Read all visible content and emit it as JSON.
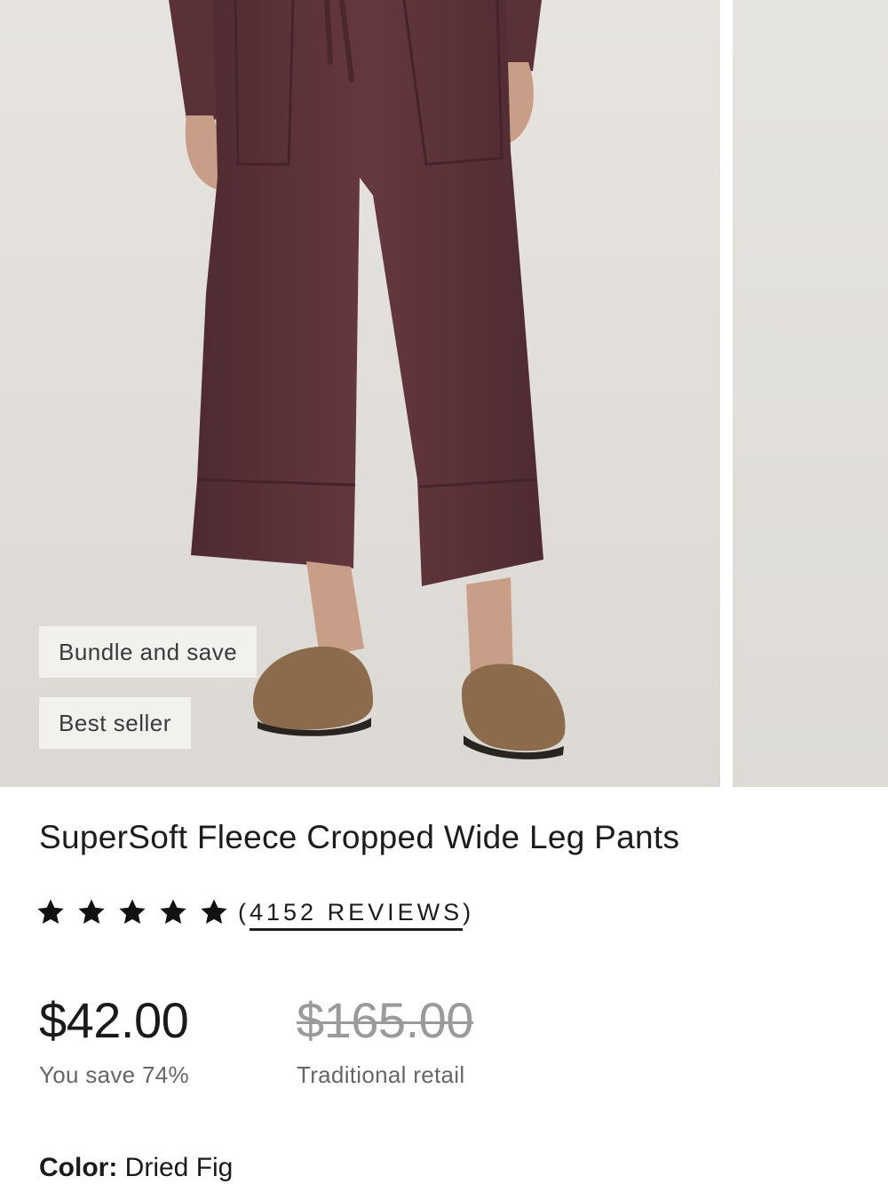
{
  "gallery": {
    "badges": [
      "Bundle and save",
      "Best seller"
    ]
  },
  "product": {
    "title": "SuperSoft Fleece Cropped Wide Leg Pants",
    "rating": {
      "stars": 5,
      "reviews_prefix": "(",
      "reviews_text": "4152 REVIEWS",
      "reviews_suffix": ")"
    },
    "price": "$42.00",
    "savings": "You save 74%",
    "retail_price": "$165.00",
    "retail_label": "Traditional retail",
    "color_label": "Color:",
    "color_value": "Dried Fig"
  },
  "colors": {
    "pants": "#5b3238",
    "background": "#e4e1dd",
    "shoe": "#8a6a4a",
    "skin": "#caa18b"
  }
}
